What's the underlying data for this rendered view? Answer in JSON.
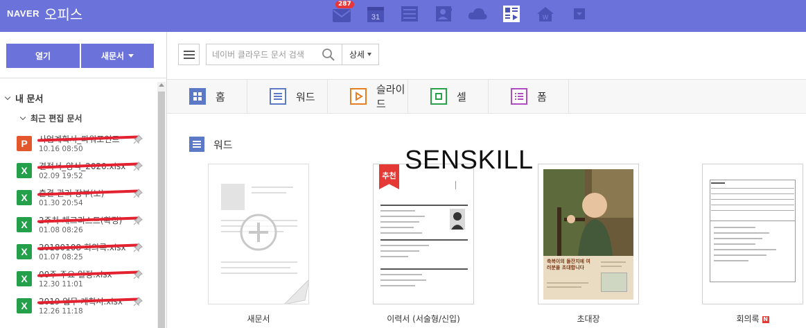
{
  "app": {
    "brand": "NAVER",
    "product": "오피스",
    "mail_badge": "287",
    "calendar_day": "31",
    "icons": [
      "mail-icon",
      "calendar-icon",
      "list-icon",
      "contacts-icon",
      "cloud-icon",
      "office-icon",
      "home-icon",
      "more-icon"
    ]
  },
  "sidebar": {
    "open_label": "열기",
    "new_doc_label": "새문서",
    "my_docs": "내 문서",
    "recent": "최근 편집 문서",
    "docs": [
      {
        "type": "ppt",
        "name": "사업계획서_파워포인트",
        "date": "10.16 08:50"
      },
      {
        "type": "xls",
        "name": "견적서_양식_2020.xlsx",
        "date": "02.09 19:52"
      },
      {
        "type": "xls",
        "name": "출결 관리 장부(보)",
        "date": "01.30 20:54"
      },
      {
        "type": "xls",
        "name": "2주차 체크리스트(확정)",
        "date": "01.08 08:26"
      },
      {
        "type": "xls",
        "name": "20180108 회의록.xlsx",
        "date": "01.07 08:25"
      },
      {
        "type": "xls",
        "name": "00주 주요 일정.xlsx",
        "date": "12.30 11:01"
      },
      {
        "type": "xls",
        "name": "2019 업무 계획서.xlsx",
        "date": "12.26 11:18"
      }
    ]
  },
  "toolbar": {
    "search_placeholder": "네이버 클라우드 문서 검색",
    "detail_label": "상세"
  },
  "tabs": [
    {
      "label": "홈",
      "icon": "home-grid-icon"
    },
    {
      "label": "워드",
      "icon": "word-icon"
    },
    {
      "label": "슬라이드",
      "icon": "slide-icon"
    },
    {
      "label": "셀",
      "icon": "cell-icon"
    },
    {
      "label": "폼",
      "icon": "form-icon"
    }
  ],
  "content": {
    "section_title": "워드",
    "templates": [
      {
        "label": "새문서"
      },
      {
        "label": "이력서 (서술형/신입)",
        "badge": "추천"
      },
      {
        "label": "초대장",
        "invite_text": "축복이의 돌잔치에 여러분을 초대합니다"
      },
      {
        "label": "회의록",
        "new": "N"
      }
    ]
  },
  "watermark": "SENSKILL",
  "colors": {
    "topbar": "#6b72d9",
    "ppt": "#e2572c",
    "xls": "#25a04a",
    "accent_red": "#e53935",
    "tab_word": "#5b79c7",
    "tab_slide": "#e67e22",
    "tab_cell": "#2aa148",
    "tab_form": "#b04bc4"
  }
}
